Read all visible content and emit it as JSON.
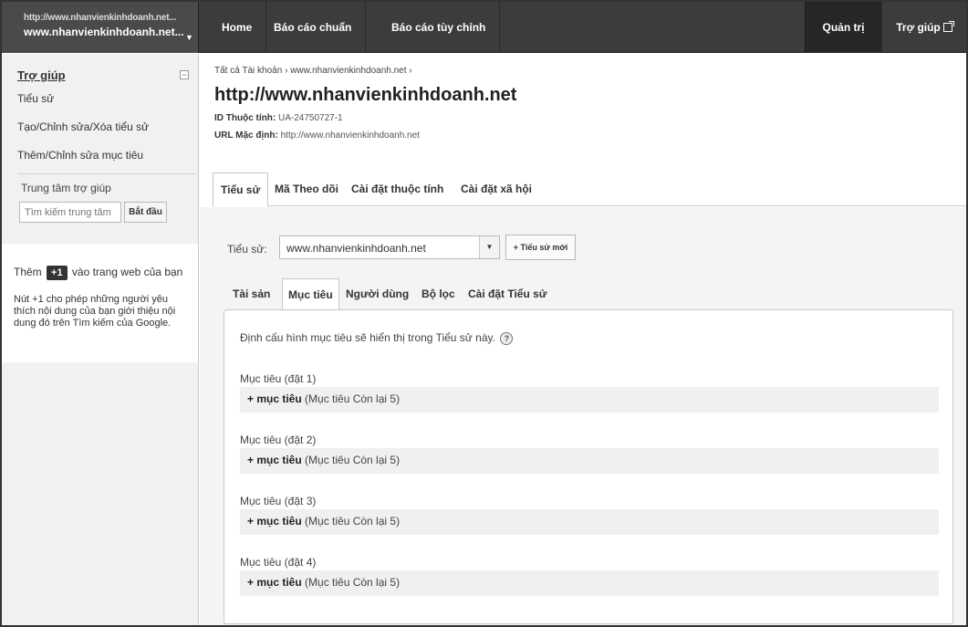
{
  "account": {
    "line1": "http://www.nhanvienkinhdoanh.net...",
    "line2": "www.nhanvienkinhdoanh.net...",
    "caret": "▼"
  },
  "nav": {
    "home": "Home",
    "standard_reports": "Báo cáo chuẩn",
    "custom_reports": "Báo cáo tùy chỉnh",
    "admin": "Quản trị",
    "help": "Trợ giúp"
  },
  "sidebar": {
    "help_title": "Trợ giúp",
    "collapse": "−",
    "links": [
      "Tiểu sử",
      "Tạo/Chỉnh sửa/Xóa tiểu sử",
      "Thêm/Chỉnh sửa mục tiêu"
    ],
    "help_center_label": "Trung tâm trợ giúp",
    "search_placeholder": "Tìm kiếm trung tâm",
    "start_button": "Bắt đầu",
    "plus_prefix": "Thêm",
    "plus_button": "+1",
    "plus_suffix": "vào trang web của bạn",
    "plus_description": "Nút +1 cho phép những người yêu thích nội dung của bạn giới thiệu nội dung đó trên Tìm kiếm của Google."
  },
  "property": {
    "breadcrumb": "Tất cả Tài khoản › www.nhanvienkinhdoanh.net ›",
    "title": "http://www.nhanvienkinhdoanh.net",
    "id_label": "ID Thuộc tính:",
    "id_value": "UA-24750727-1",
    "url_label": "URL Mặc định:",
    "url_value": "http://www.nhanvienkinhdoanh.net"
  },
  "main_tabs": [
    "Tiểu sử",
    "Mã Theo dõi",
    "Cài đặt thuộc tính",
    "Cài đặt xã hội"
  ],
  "profile": {
    "label": "Tiểu sử:",
    "selected": "www.nhanvienkinhdoanh.net",
    "arrow": "▼",
    "new_button": "+ Tiểu sử mới"
  },
  "profile_tabs": [
    "Tài sản",
    "Mục tiêu",
    "Người dùng",
    "Bộ lọc",
    "Cài đặt Tiểu sử"
  ],
  "goals": {
    "intro": "Định cấu hình mục tiêu sẽ hiển thị trong Tiểu sử này.",
    "help": "?",
    "sets": [
      {
        "label": "Mục tiêu (đặt 1)",
        "add": "+ mục tiêu",
        "remaining": "(Mục tiêu Còn lại 5)"
      },
      {
        "label": "Mục tiêu (đặt 2)",
        "add": "+ mục tiêu",
        "remaining": "(Mục tiêu Còn lại 5)"
      },
      {
        "label": "Mục tiêu (đặt 3)",
        "add": "+ mục tiêu",
        "remaining": "(Mục tiêu Còn lại 5)"
      },
      {
        "label": "Mục tiêu (đặt 4)",
        "add": "+ mục tiêu",
        "remaining": "(Mục tiêu Còn lại 5)"
      }
    ]
  }
}
